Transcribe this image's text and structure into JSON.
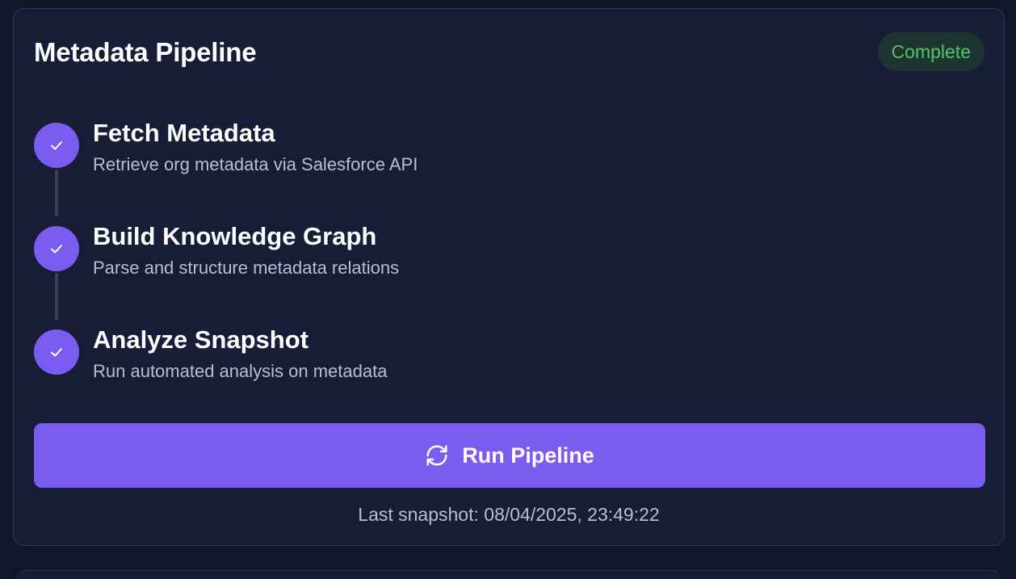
{
  "pipeline": {
    "title": "Metadata Pipeline",
    "status": "Complete",
    "steps": [
      {
        "title": "Fetch Metadata",
        "description": "Retrieve org metadata via Salesforce API",
        "state": "done"
      },
      {
        "title": "Build Knowledge Graph",
        "description": "Parse and structure metadata relations",
        "state": "done"
      },
      {
        "title": "Analyze Snapshot",
        "description": "Run automated analysis on metadata",
        "state": "done"
      }
    ],
    "run_button_label": "Run Pipeline",
    "run_button_icon": "refresh-icon",
    "last_snapshot": "Last snapshot: 08/04/2025, 23:49:22"
  },
  "colors": {
    "page_bg": "#111729",
    "card_bg": "#171c37",
    "accent": "#7a5cf0",
    "status_text": "#56c26d",
    "status_bg": "#1d3530"
  }
}
